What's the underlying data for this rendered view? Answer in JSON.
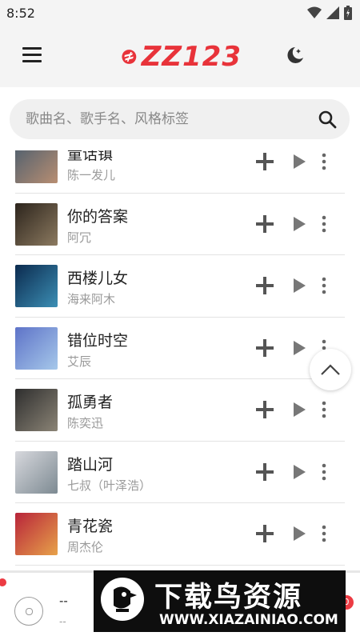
{
  "status_bar": {
    "time": "8:52"
  },
  "header": {
    "logo_text": "ZZ123",
    "brand_color": "#e8333a"
  },
  "search": {
    "placeholder": "歌曲名、歌手名、风格标签",
    "value": ""
  },
  "songs": [
    {
      "title": "童话镇",
      "artist": "陈一发儿",
      "cover_colors": [
        "#4a5d6e",
        "#b88e72"
      ]
    },
    {
      "title": "你的答案",
      "artist": "阿冗",
      "cover_colors": [
        "#2c241c",
        "#8c7a60"
      ]
    },
    {
      "title": "西楼儿女",
      "artist": "海来阿木",
      "cover_colors": [
        "#0b2a4e",
        "#3c8fb5"
      ]
    },
    {
      "title": "错位时空",
      "artist": "艾辰",
      "cover_colors": [
        "#5e73c8",
        "#a6c8ea"
      ]
    },
    {
      "title": "孤勇者",
      "artist": "陈奕迅",
      "cover_colors": [
        "#2e2e2e",
        "#8b8476"
      ]
    },
    {
      "title": "踏山河",
      "artist": "七叔（叶泽浩）",
      "cover_colors": [
        "#d7d8dd",
        "#7d8a92"
      ]
    },
    {
      "title": "青花瓷",
      "artist": "周杰伦",
      "cover_colors": [
        "#b8243a",
        "#e7a24a"
      ]
    },
    {
      "title": "",
      "artist": "",
      "cover_colors": [
        "#3a3a3a",
        "#6a6a6a"
      ]
    }
  ],
  "player": {
    "title": "--",
    "artist": "--",
    "queue_count": "0",
    "accent": "#ec3b43"
  },
  "watermark": {
    "title": "下载鸟资源",
    "url": "WWW.XIAZAINIAO.COM"
  }
}
